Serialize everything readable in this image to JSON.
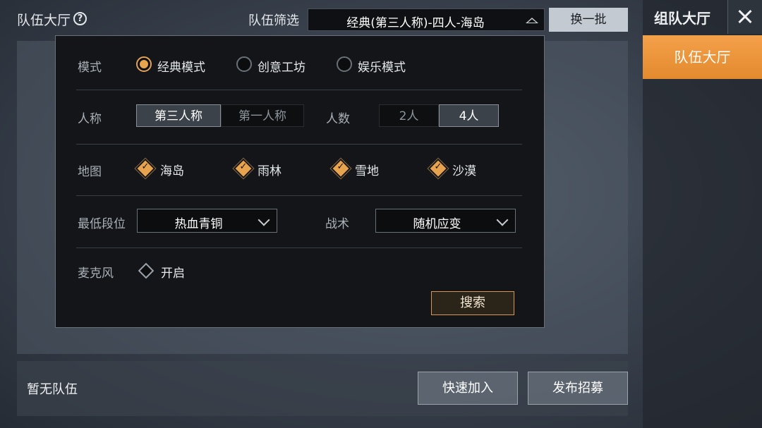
{
  "header": {
    "title": "队伍大厅",
    "help_icon": "question-circle-icon",
    "filter_label": "队伍筛选",
    "filter_value": "经典(第三人称)-四人-海岛",
    "refresh_label": "换一批"
  },
  "sidebar": {
    "title": "组队大厅",
    "close_icon": "close-icon",
    "items": [
      {
        "label": "队伍大厅",
        "active": true
      }
    ]
  },
  "filter_panel": {
    "mode": {
      "label": "模式",
      "options": [
        {
          "label": "经典模式",
          "selected": true
        },
        {
          "label": "创意工坊",
          "selected": false
        },
        {
          "label": "娱乐模式",
          "selected": false
        }
      ]
    },
    "perspective": {
      "label": "人称",
      "options": [
        {
          "label": "第三人称",
          "selected": true
        },
        {
          "label": "第一人称",
          "selected": false
        }
      ]
    },
    "team_size": {
      "label": "人数",
      "options": [
        {
          "label": "2人",
          "selected": false
        },
        {
          "label": "4人",
          "selected": true
        }
      ]
    },
    "map": {
      "label": "地图",
      "options": [
        {
          "label": "海岛",
          "checked": true
        },
        {
          "label": "雨林",
          "checked": true
        },
        {
          "label": "雪地",
          "checked": true
        },
        {
          "label": "沙漠",
          "checked": true
        }
      ]
    },
    "min_rank": {
      "label": "最低段位",
      "value": "热血青铜"
    },
    "tactics": {
      "label": "战术",
      "value": "随机应变"
    },
    "microphone": {
      "label": "麦克风",
      "option": "开启",
      "checked": false
    },
    "search_label": "搜索"
  },
  "list": {
    "empty_text": "暂无队伍",
    "quick_join_label": "快速加入",
    "post_recruit_label": "发布招募"
  },
  "colors": {
    "accent_orange": "#e8a34e",
    "sidebar_active": "#f09a40"
  }
}
